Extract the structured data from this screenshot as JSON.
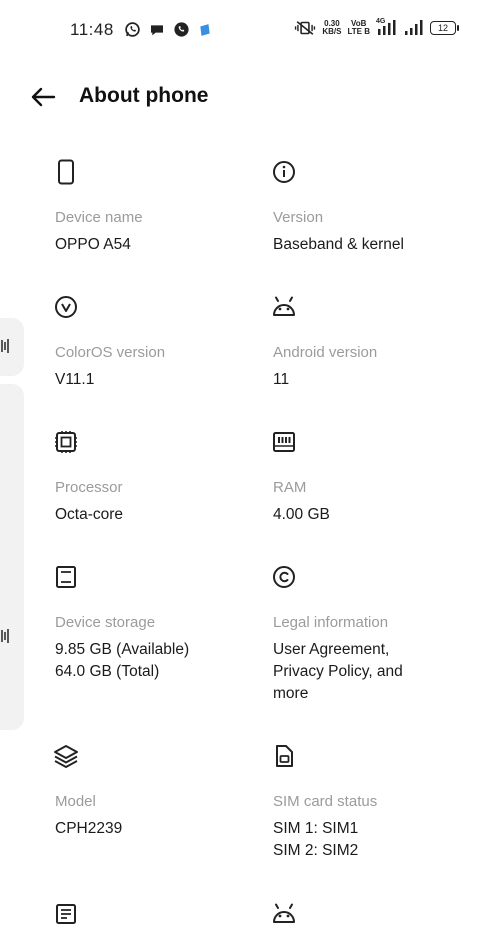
{
  "status_bar": {
    "time": "11:48",
    "notification_icons": [
      "whatsapp-icon",
      "chat-bubble-icon",
      "whatsapp-business-icon",
      "app-icon"
    ],
    "net_speed_value": "0.30",
    "net_speed_unit": "KB/S",
    "volte_top": "VoB",
    "volte_bottom": "LTE B",
    "network_type": "4G",
    "battery_level": "12"
  },
  "header": {
    "back_icon": "arrow-left-icon",
    "title": "About phone"
  },
  "items": [
    {
      "icon": "phone-icon",
      "label": "Device name",
      "value_lines": [
        "OPPO A54"
      ]
    },
    {
      "icon": "info-icon",
      "label": "Version",
      "value_lines": [
        "Baseband & kernel"
      ]
    },
    {
      "icon": "coloros-icon",
      "label": "ColorOS version",
      "value_lines": [
        "V11.1"
      ]
    },
    {
      "icon": "android-icon",
      "label": "Android version",
      "value_lines": [
        "11"
      ]
    },
    {
      "icon": "chip-icon",
      "label": "Processor",
      "value_lines": [
        "Octa-core"
      ]
    },
    {
      "icon": "ram-icon",
      "label": "RAM",
      "value_lines": [
        "4.00 GB"
      ]
    },
    {
      "icon": "storage-icon",
      "label": "Device storage",
      "value_lines": [
        "9.85 GB (Available)",
        "64.0 GB (Total)"
      ]
    },
    {
      "icon": "copyright-icon",
      "label": "Legal information",
      "value_lines": [
        "User Agreement,",
        "Privacy Policy, and",
        "more"
      ]
    },
    {
      "icon": "layers-icon",
      "label": "Model",
      "value_lines": [
        "CPH2239"
      ]
    },
    {
      "icon": "sim-card-icon",
      "label": "SIM card status",
      "value_lines": [
        "SIM 1: SIM1",
        "SIM 2: SIM2"
      ]
    },
    {
      "icon": "document-icon",
      "label": "",
      "value_lines": []
    },
    {
      "icon": "android-icon",
      "label": "",
      "value_lines": []
    }
  ]
}
